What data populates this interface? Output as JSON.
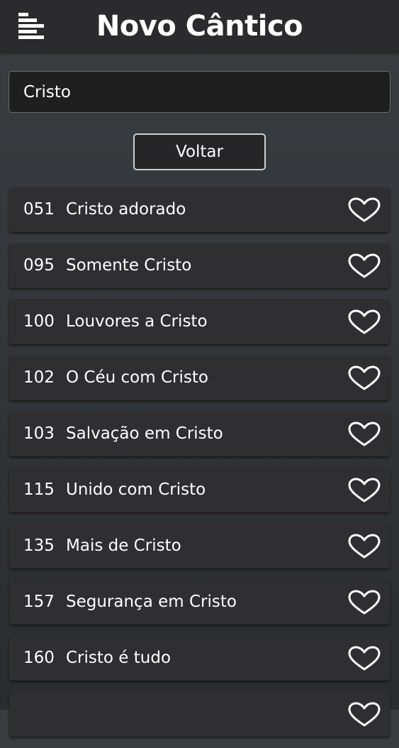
{
  "app": {
    "title": "Novo Cântico",
    "menu_icon": "menu-icon"
  },
  "search": {
    "value": "Cristo",
    "placeholder": ""
  },
  "back_button": {
    "label": "Voltar"
  },
  "hymns": [
    {
      "number": "051",
      "title": "Cristo adorado",
      "icon": "heart-outline-icon"
    },
    {
      "number": "095",
      "title": "Somente Cristo",
      "icon": "heart-outline-icon"
    },
    {
      "number": "100",
      "title": "Louvores a Cristo",
      "icon": "heart-outline-icon"
    },
    {
      "number": "102",
      "title": "O Céu com Cristo",
      "icon": "heart-outline-icon"
    },
    {
      "number": "103",
      "title": "Salvação em Cristo",
      "icon": "heart-outline-icon"
    },
    {
      "number": "115",
      "title": "Unido com Cristo",
      "icon": "heart-outline-icon"
    },
    {
      "number": "135",
      "title": "Mais de Cristo",
      "icon": "heart-outline-icon"
    },
    {
      "number": "157",
      "title": "Segurança em Cristo",
      "icon": "heart-outline-icon"
    },
    {
      "number": "160",
      "title": "Cristo é tudo",
      "icon": "heart-outline-icon"
    },
    {
      "number": "",
      "title": "",
      "icon": "heart-outline-icon"
    }
  ],
  "colors": {
    "app_bar": "#2b2b2d",
    "background": "#36383c",
    "card": "#2f2f31",
    "text": "#ffffff"
  }
}
